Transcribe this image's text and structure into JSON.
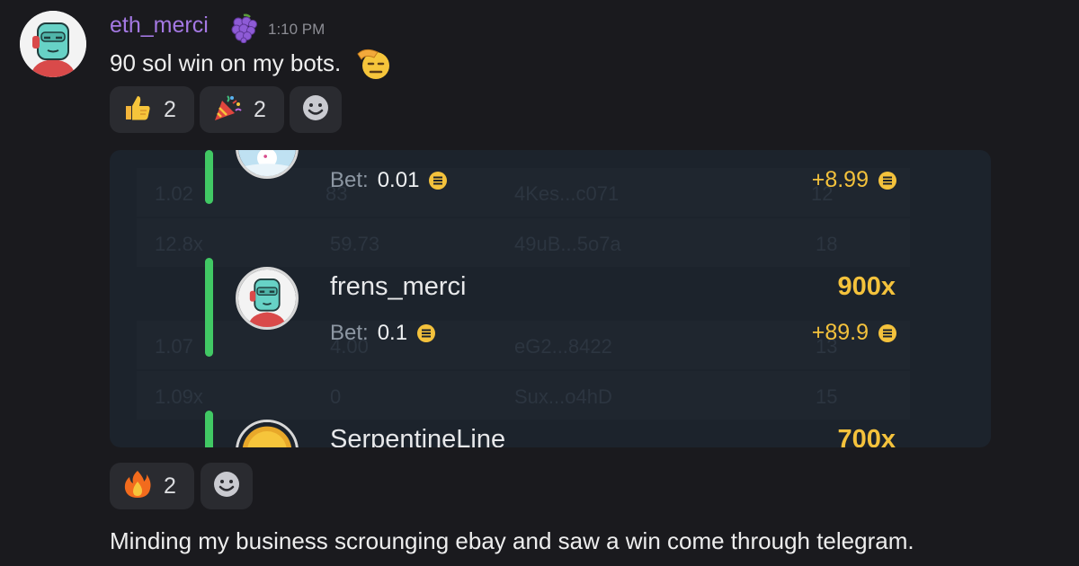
{
  "message": {
    "username": "eth_merci",
    "timestamp": "1:10 PM",
    "text": "90 sol win on my bots.",
    "badge_icon": "grapes-icon",
    "inline_emoji": "saluting-face-emoji"
  },
  "reactions_top": [
    {
      "emoji": "thumbs-up",
      "count": "2"
    },
    {
      "emoji": "party-popper",
      "count": "2"
    }
  ],
  "embed": {
    "rows": [
      {
        "name": "",
        "bet_label": "Bet:",
        "bet_amount": "0.01",
        "multiplier": "",
        "payout": "+8.99",
        "avatar": "snow-avatar"
      },
      {
        "name": "frens_merci",
        "bet_label": "Bet:",
        "bet_amount": "0.1",
        "multiplier": "900x",
        "payout": "+89.9",
        "avatar": "robot-avatar"
      },
      {
        "name": "SerpentineLine",
        "bet_label": "",
        "bet_amount": "",
        "multiplier": "700x",
        "payout": "",
        "avatar": "gold-coin-avatar"
      }
    ],
    "background_rows": [
      {
        "col1": "1.02",
        "col2": "83",
        "col3": "4Kes...c071",
        "col4": "12"
      },
      {
        "col1": "12.8x",
        "col2": "59.73",
        "col3": "49uB...5o7a",
        "col4": "18"
      },
      {
        "col1": "1.07",
        "col2": "4.00",
        "col3": "eG2...8422",
        "col4": "13"
      },
      {
        "col1": "1.09x",
        "col2": "0",
        "col3": "Sux...o4hD",
        "col4": "15"
      }
    ]
  },
  "reactions_bottom": [
    {
      "emoji": "fire",
      "count": "2"
    }
  ],
  "followup_text": "Minding my business scrounging ebay and saw a win come through telegram.",
  "colors": {
    "username": "#a478e3",
    "accent_green": "#41c864",
    "gold": "#f4c23c"
  }
}
